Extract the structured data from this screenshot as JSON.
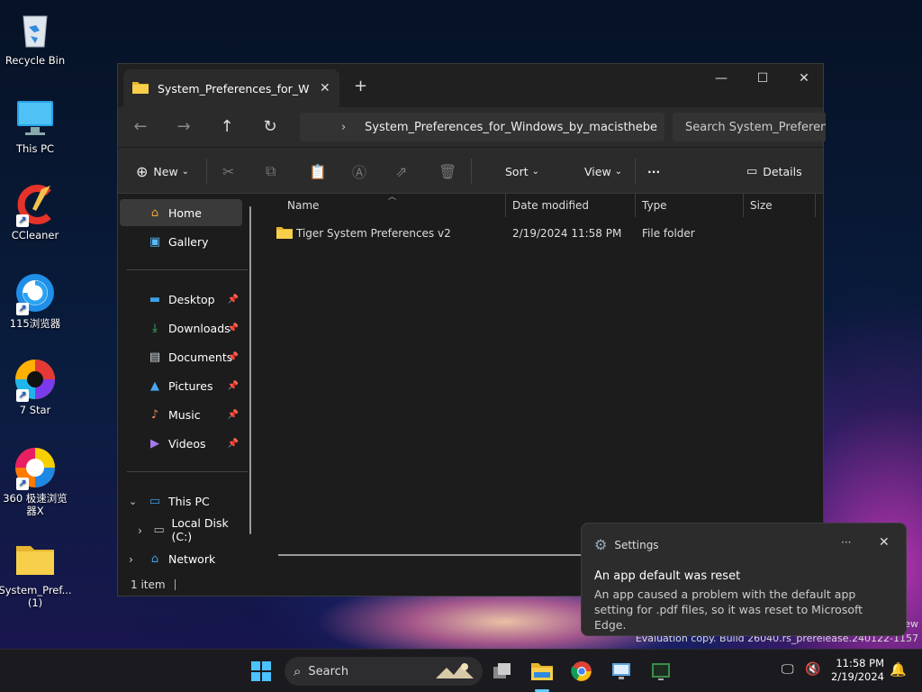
{
  "desktop": {
    "icons": [
      {
        "label": "Recycle Bin"
      },
      {
        "label": "This PC"
      },
      {
        "label": "CCleaner"
      },
      {
        "label": "115浏览器"
      },
      {
        "label": "7 Star"
      },
      {
        "label": "360 极速浏览器X"
      },
      {
        "label": "System_Pref...(1)"
      }
    ]
  },
  "explorer": {
    "tab_title": "System_Preferences_for_Windows_by_macisthebe",
    "address": {
      "path": "System_Preferences_for_Windows_by_macisthebe"
    },
    "search": {
      "placeholder": "Search System_Preferences"
    },
    "toolbar": {
      "new": "New",
      "sort": "Sort",
      "view": "View",
      "more": "···",
      "details": "Details"
    },
    "sidebar": {
      "home": "Home",
      "gallery": "Gallery",
      "desktop": "Desktop",
      "downloads": "Downloads",
      "documents": "Documents",
      "pictures": "Pictures",
      "music": "Music",
      "videos": "Videos",
      "this_pc": "This PC",
      "local_disk": "Local Disk (C:)",
      "network": "Network"
    },
    "columns": {
      "name": "Name",
      "date_modified": "Date modified",
      "type": "Type",
      "size": "Size"
    },
    "files": [
      {
        "name": "Tiger System Preferences v2",
        "date": "2/19/2024 11:58 PM",
        "type": "File folder",
        "size": ""
      }
    ],
    "status": "1 item"
  },
  "notification": {
    "app": "Settings",
    "more": "···",
    "title": "An app default was reset",
    "body": "An app caused a problem with the default app setting for .pdf files, so it was reset to Microsoft Edge."
  },
  "watermark": {
    "line1": "ew",
    "line2": "Evaluation copy. Build 26040.rs_prerelease.240122-1157"
  },
  "taskbar": {
    "search_label": "Search",
    "time": "11:58 PM",
    "date": "2/19/2024"
  }
}
